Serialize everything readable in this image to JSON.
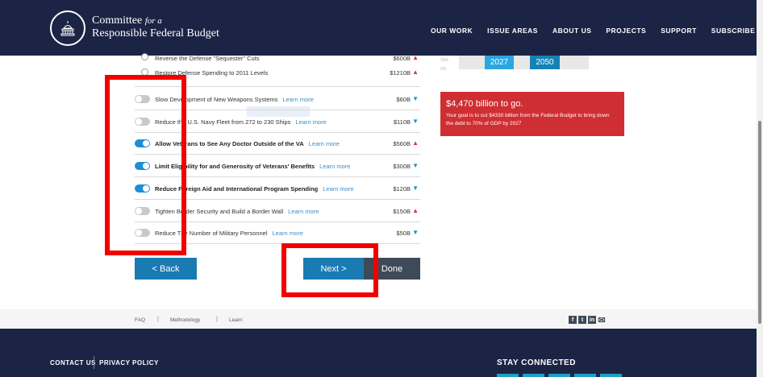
{
  "header": {
    "brand_line1": "Committee",
    "brand_line1_italic": "for a",
    "brand_line2": "Responsible Federal Budget",
    "nav": [
      "OUR WORK",
      "ISSUE AREAS",
      "ABOUT US",
      "PROJECTS",
      "SUPPORT",
      "SUBSCRIBE"
    ]
  },
  "radio_options": [
    {
      "label": "Reverse the Defense \"Sequester\" Cuts",
      "amount": "$600B",
      "direction": "up"
    },
    {
      "label": "Restore Defense Spending to 2011 Levels",
      "amount": "$1210B",
      "direction": "up"
    }
  ],
  "learn_more": "Learn more",
  "toggle_options": [
    {
      "label": "Slow Development of New Weapons Systems",
      "amount": "$60B",
      "direction": "down",
      "on": false
    },
    {
      "label": "Reduce the U.S. Navy Fleet from 272 to 230 Ships",
      "amount": "$110B",
      "direction": "down",
      "on": false
    },
    {
      "label": "Allow Veterans to See Any Doctor Outside of the VA",
      "amount": "$560B",
      "direction": "up",
      "on": true
    },
    {
      "label": "Limit Eligibility for and Generosity of Veterans' Benefits",
      "amount": "$300B",
      "direction": "down",
      "on": true
    },
    {
      "label": "Reduce Foreign Aid and International Program Spending",
      "amount": "$120B",
      "direction": "down",
      "on": true
    },
    {
      "label": "Tighten Border Security and Build a Border Wall",
      "amount": "$150B",
      "direction": "up",
      "on": false
    },
    {
      "label": "Reduce The Number of Military Personnel",
      "amount": "$50B",
      "direction": "down",
      "on": false
    }
  ],
  "buttons": {
    "back": "< Back",
    "next": "Next >",
    "done": "Done"
  },
  "mini_chart": {
    "ticks": [
      "10%",
      "0%"
    ],
    "years": [
      "2027",
      "2050"
    ]
  },
  "goal": {
    "title": "$4,470 billion to go.",
    "body": "Your goal is to cut $4330 billion from the Federal Budget to bring down the debt to 70% of GDP by 2027"
  },
  "footer_links": [
    "FAQ",
    "Methodology",
    "Learn"
  ],
  "footer": {
    "contact": "CONTACT US",
    "privacy": "PRIVACY POLICY",
    "stay": "STAY CONNECTED"
  },
  "social_icons": [
    "facebook-icon",
    "twitter-icon",
    "linkedin-icon",
    "mail-icon"
  ],
  "colors": {
    "navy": "#1c2445",
    "blue": "#1a7bb3",
    "red_goal": "#cf2e33",
    "highlight": "#f20000"
  }
}
